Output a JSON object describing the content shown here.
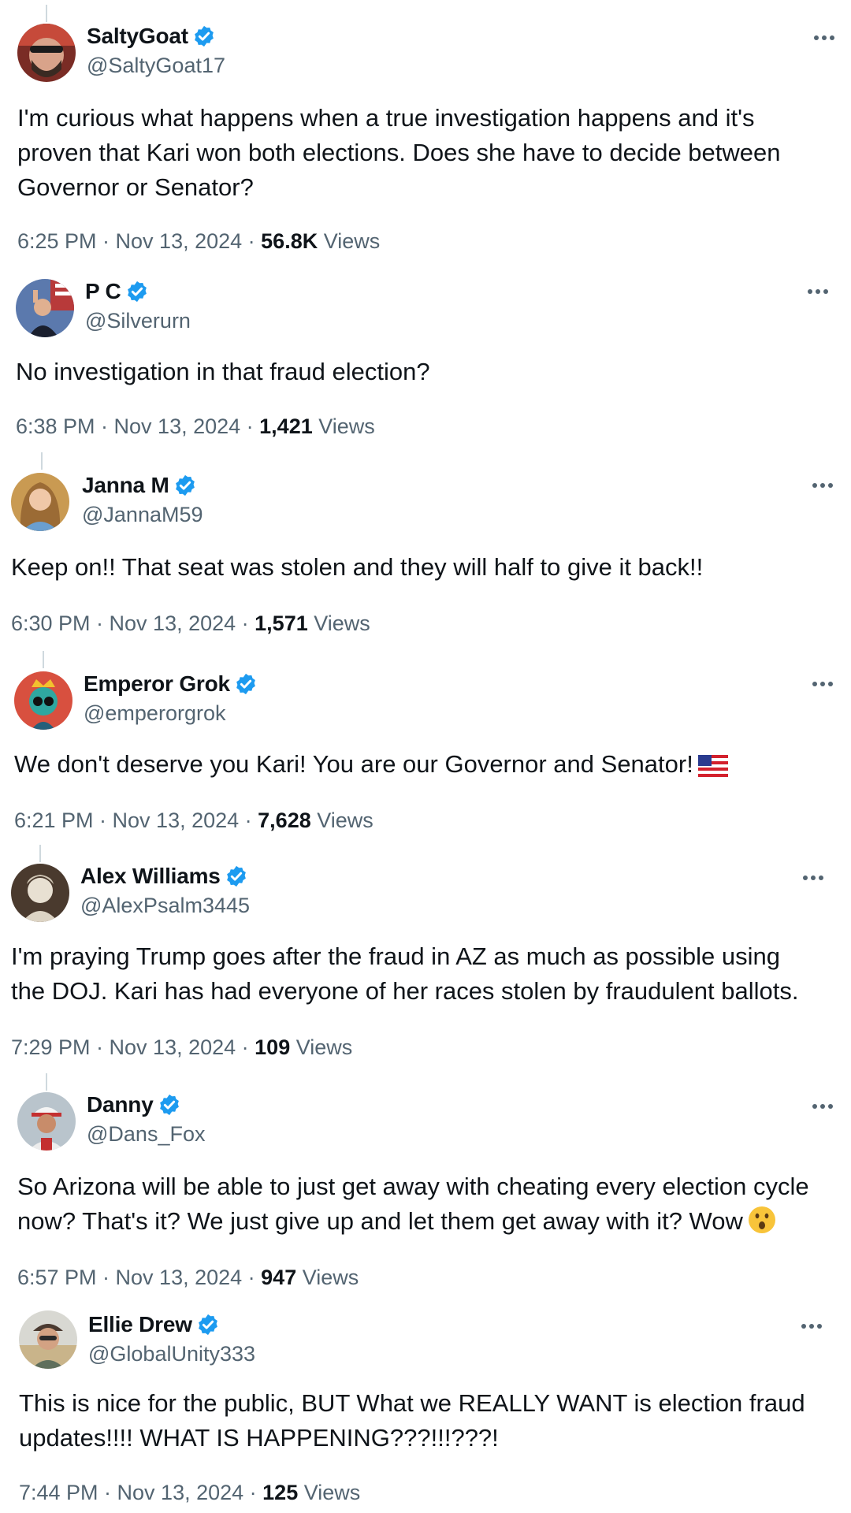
{
  "tweets": [
    {
      "name": "SaltyGoat",
      "handle": "@SaltyGoat17",
      "lines": [
        "I'm curious what happens when a true investigation happens and it's",
        "proven that Kari won both elections.  Does she have to decide between",
        "Governor or Senator?"
      ],
      "time": "6:25 PM · Nov 13, 2024 · ",
      "views_count": "56.8K",
      "views_label": " Views"
    },
    {
      "name": "P C",
      "handle": "@Silverurn",
      "lines": [
        "No investigation in that fraud election?"
      ],
      "time": "6:38 PM · Nov 13, 2024 · ",
      "views_count": "1,421",
      "views_label": " Views"
    },
    {
      "name": "Janna M",
      "handle": "@JannaM59",
      "lines": [
        "Keep on!! That seat was stolen and they will half to give it back!!"
      ],
      "time": "6:30 PM · Nov 13, 2024 · ",
      "views_count": "1,571",
      "views_label": " Views"
    },
    {
      "name": "Emperor Grok",
      "handle": "@emperorgrok",
      "lines": [
        "We don't deserve you Kari! You are our Governor and Senator!"
      ],
      "emoji": "us-flag",
      "time": "6:21 PM · Nov 13, 2024 · ",
      "views_count": "7,628",
      "views_label": " Views"
    },
    {
      "name": "Alex Williams",
      "handle": "@AlexPsalm3445",
      "lines": [
        "I'm praying Trump goes after the fraud in AZ as much as possible using",
        "the DOJ. Kari has had everyone of her races stolen by fraudulent ballots."
      ],
      "time": "7:29 PM · Nov 13, 2024 · ",
      "views_count": "109",
      "views_label": " Views"
    },
    {
      "name": "Danny",
      "handle": "@Dans_Fox",
      "lines": [
        "So Arizona will be able to just get away with cheating every election cycle",
        "now? That's it? We just give up and let them get away with it? Wow"
      ],
      "emoji": "surprised-face",
      "time": "6:57 PM · Nov 13, 2024 · ",
      "views_count": "947",
      "views_label": " Views"
    },
    {
      "name": "Ellie Drew",
      "handle": "@GlobalUnity333",
      "lines": [
        "This is nice for the public, BUT What we REALLY WANT is election fraud",
        "updates!!!! WHAT IS HAPPENING???!!!???!"
      ],
      "time": "7:44 PM · Nov 13, 2024 · ",
      "views_count": "125",
      "views_label": " Views"
    }
  ],
  "colors": {
    "text": "#0f1419",
    "secondary": "#536471",
    "verified": "#1d9bf0"
  },
  "icons": {
    "verified": "verified-badge-icon",
    "more": "more-options-icon"
  }
}
